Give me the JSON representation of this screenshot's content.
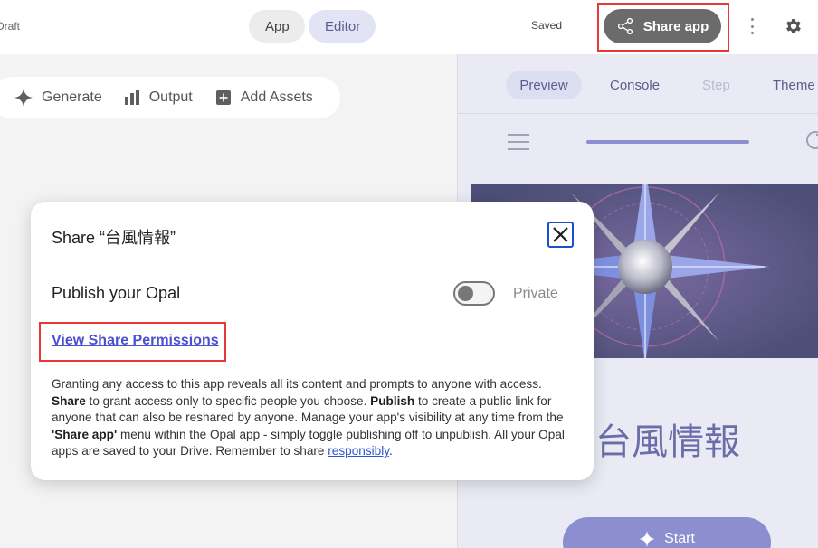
{
  "header": {
    "draft_label": "Draft",
    "modes": [
      "App",
      "Editor"
    ],
    "active_mode": "Editor",
    "saved_status": "Saved",
    "share_button_label": "Share app"
  },
  "editor_toolbar": {
    "items": [
      {
        "label": "Generate",
        "icon": "sparkle-icon"
      },
      {
        "label": "Output",
        "icon": "chart-icon"
      },
      {
        "label": "Add Assets",
        "icon": "add-box-icon"
      }
    ]
  },
  "preview": {
    "tabs": [
      "Preview",
      "Console",
      "Step",
      "Theme"
    ],
    "active_tab": "Preview",
    "disabled_tab": "Step",
    "app_title": "台風情報",
    "start_label": "Start"
  },
  "share_dialog": {
    "title": "Share “台風情報”",
    "publish_label": "Publish your Opal",
    "toggle_state": "Private",
    "toggle_on": false,
    "permissions_link": "View Share Permissions",
    "body_1": "Granting any access to this app reveals all its content and prompts to anyone with access. ",
    "body_share": "Share",
    "body_2": " to grant access only to specific people you choose. ",
    "body_publish": "Publish",
    "body_3": " to create a public link for anyone that can also be reshared by anyone. Manage your app's visibility at any time from the ",
    "body_share_app": "'Share app'",
    "body_4": " menu within the Opal app - simply toggle publishing off to unpublish. All your Opal apps are saved to your Drive. Remember to share ",
    "body_link": "responsibly",
    "body_5": "."
  },
  "colors": {
    "accent": "#5a5d8e",
    "highlight": "#e53935",
    "share_button": "#6b6b6b",
    "link": "#4b4fd1",
    "start_button": "#8b8fcf"
  }
}
